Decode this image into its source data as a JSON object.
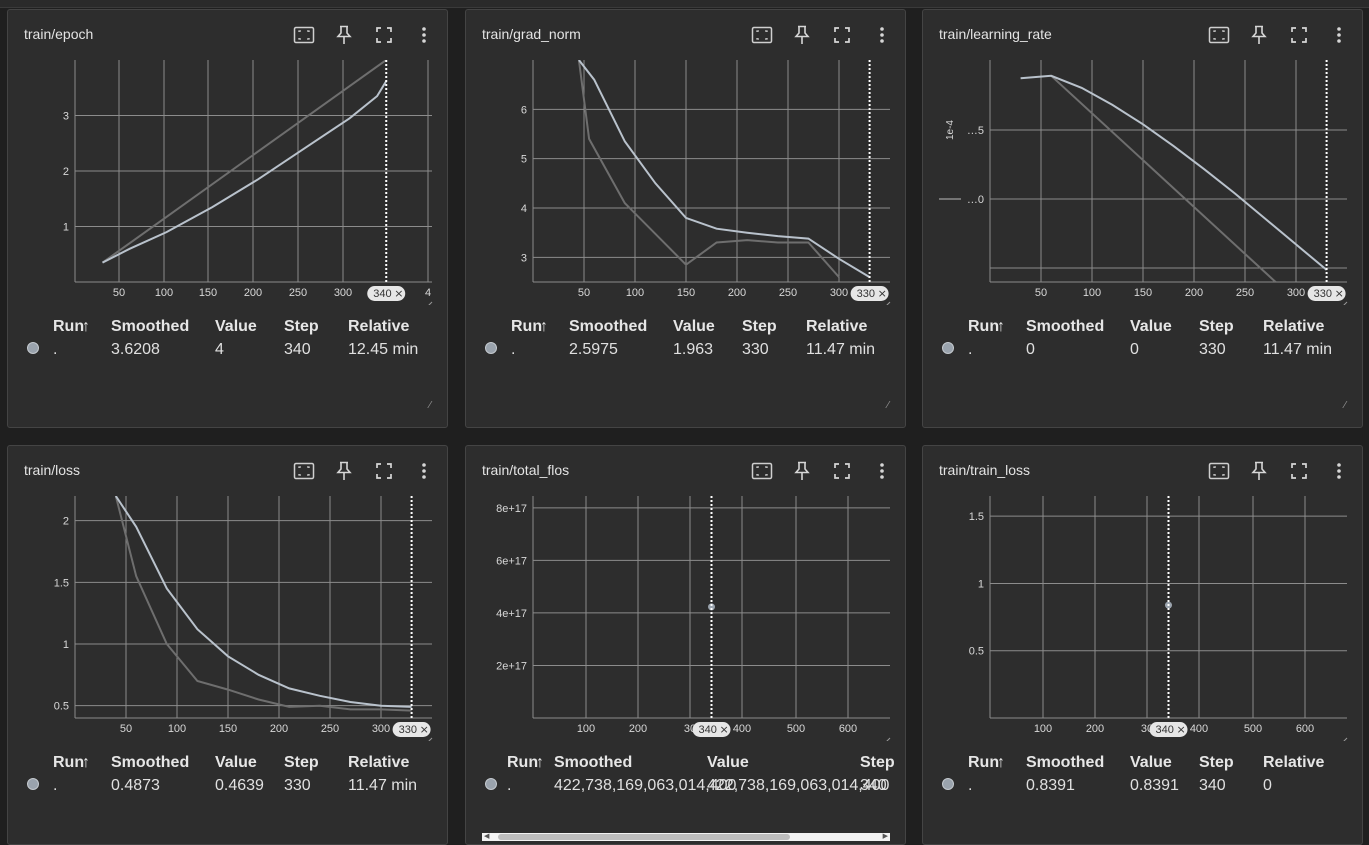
{
  "header": {
    "sort_arrow": "↑"
  },
  "cards": [
    {
      "title": "train/epoch",
      "plot": {
        "y_ticks": [
          "3",
          "2",
          "1"
        ],
        "x_ticks": [
          "50",
          "100",
          "150",
          "200",
          "250",
          "300",
          "4"
        ],
        "badge": "340",
        "y_axis_label": ""
      },
      "table": {
        "headers": [
          "Run",
          "Smoothed",
          "Value",
          "Step",
          "Relative"
        ],
        "row": {
          "run": ".",
          "smoothed": "3.6208",
          "value": "4",
          "step": "340",
          "relative": "12.45 min"
        }
      },
      "series_smoothed": [
        [
          30,
          0.35
        ],
        [
          60,
          0.6
        ],
        [
          100,
          0.9
        ],
        [
          150,
          1.35
        ],
        [
          200,
          1.85
        ],
        [
          250,
          2.4
        ],
        [
          300,
          2.95
        ],
        [
          330,
          3.35
        ],
        [
          340,
          3.62
        ]
      ],
      "series_raw": [
        [
          30,
          0.35
        ],
        [
          340,
          4.0
        ]
      ],
      "x_range": [
        0,
        390
      ],
      "y_range": [
        0,
        4
      ],
      "cursor_step": 340
    },
    {
      "title": "train/grad_norm",
      "plot": {
        "y_ticks": [
          "6",
          "5",
          "4",
          "3"
        ],
        "x_ticks": [
          "50",
          "100",
          "150",
          "200",
          "250",
          "300"
        ],
        "badge": "330",
        "y_axis_label": ""
      },
      "table": {
        "headers": [
          "Run",
          "Smoothed",
          "Value",
          "Step",
          "Relative"
        ],
        "row": {
          "run": ".",
          "smoothed": "2.5975",
          "value": "1.963",
          "step": "330",
          "relative": "11.47 min"
        }
      },
      "series_smoothed": [
        [
          45,
          7.0
        ],
        [
          60,
          6.6
        ],
        [
          90,
          5.35
        ],
        [
          120,
          4.5
        ],
        [
          150,
          3.8
        ],
        [
          180,
          3.58
        ],
        [
          210,
          3.5
        ],
        [
          240,
          3.43
        ],
        [
          270,
          3.38
        ],
        [
          300,
          2.97
        ],
        [
          330,
          2.6
        ]
      ],
      "series_raw": [
        [
          45,
          7.0
        ],
        [
          55,
          5.4
        ],
        [
          90,
          4.1
        ],
        [
          150,
          2.85
        ],
        [
          180,
          3.3
        ],
        [
          210,
          3.35
        ],
        [
          240,
          3.3
        ],
        [
          270,
          3.3
        ],
        [
          300,
          2.6
        ]
      ],
      "x_range": [
        0,
        350
      ],
      "y_range": [
        2.5,
        7.0
      ],
      "cursor_step": 330
    },
    {
      "title": "train/learning_rate",
      "plot": {
        "y_ticks": [
          "…5",
          "…0"
        ],
        "x_ticks": [
          "50",
          "100",
          "150",
          "200",
          "250",
          "300"
        ],
        "badge": "330",
        "y_axis_label": "1e-4"
      },
      "table": {
        "headers": [
          "Run",
          "Smoothed",
          "Value",
          "Step",
          "Relative"
        ],
        "row": {
          "run": ".",
          "smoothed": "0",
          "value": "0",
          "step": "330",
          "relative": "11.47 min"
        }
      },
      "series_smoothed": [
        [
          30,
          1.8
        ],
        [
          60,
          1.82
        ],
        [
          90,
          1.72
        ],
        [
          120,
          1.58
        ],
        [
          150,
          1.42
        ],
        [
          180,
          1.24
        ],
        [
          210,
          1.05
        ],
        [
          240,
          0.85
        ],
        [
          270,
          0.64
        ],
        [
          300,
          0.43
        ],
        [
          330,
          0.22
        ]
      ],
      "series_raw": [
        [
          60,
          1.82
        ],
        [
          280,
          0.12
        ]
      ],
      "x_range": [
        0,
        350
      ],
      "y_range": [
        0.12,
        1.95
      ],
      "cursor_step": 330
    },
    {
      "title": "train/loss",
      "plot": {
        "y_ticks": [
          "2",
          "1.5",
          "1",
          "0.5"
        ],
        "x_ticks": [
          "50",
          "100",
          "150",
          "200",
          "250",
          "300"
        ],
        "badge": "330",
        "y_axis_label": ""
      },
      "table": {
        "headers": [
          "Run",
          "Smoothed",
          "Value",
          "Step",
          "Relative"
        ],
        "row": {
          "run": ".",
          "smoothed": "0.4873",
          "value": "0.4639",
          "step": "330",
          "relative": "11.47 min"
        }
      },
      "series_smoothed": [
        [
          40,
          2.2
        ],
        [
          60,
          1.95
        ],
        [
          90,
          1.45
        ],
        [
          120,
          1.12
        ],
        [
          150,
          0.9
        ],
        [
          180,
          0.75
        ],
        [
          210,
          0.64
        ],
        [
          240,
          0.58
        ],
        [
          270,
          0.53
        ],
        [
          300,
          0.5
        ],
        [
          330,
          0.49
        ]
      ],
      "series_raw": [
        [
          40,
          2.2
        ],
        [
          60,
          1.55
        ],
        [
          90,
          1.0
        ],
        [
          120,
          0.7
        ],
        [
          150,
          0.63
        ],
        [
          180,
          0.55
        ],
        [
          210,
          0.49
        ],
        [
          240,
          0.5
        ],
        [
          270,
          0.47
        ],
        [
          300,
          0.47
        ],
        [
          330,
          0.46
        ]
      ],
      "x_range": [
        0,
        350
      ],
      "y_range": [
        0.4,
        2.2
      ],
      "cursor_step": 330
    },
    {
      "title": "train/total_flos",
      "plot": {
        "y_ticks": [
          "8e+17",
          "6e+17",
          "4e+17",
          "2e+17"
        ],
        "x_ticks": [
          "100",
          "200",
          "30",
          "400",
          "500",
          "600"
        ],
        "badge": "340",
        "y_axis_label": ""
      },
      "table": {
        "headers": [
          "Run",
          "Smoothed",
          "Value",
          "Step"
        ],
        "row": {
          "run": ".",
          "smoothed": "422,738,169,063,014,400",
          "value": "422,738,169,063,014,400",
          "step": "340"
        }
      },
      "series_smoothed": [],
      "series_raw": [],
      "point": [
        340,
        4.23
      ],
      "x_range": [
        0,
        680
      ],
      "y_range": [
        0,
        8.45
      ],
      "cursor_step": 340
    },
    {
      "title": "train/train_loss",
      "plot": {
        "y_ticks": [
          "1.5",
          "1",
          "0.5"
        ],
        "x_ticks": [
          "100",
          "200",
          "30",
          "400",
          "500",
          "600"
        ],
        "badge": "340",
        "y_axis_label": ""
      },
      "table": {
        "headers": [
          "Run",
          "Smoothed",
          "Value",
          "Step",
          "Relative"
        ],
        "row": {
          "run": ".",
          "smoothed": "0.8391",
          "value": "0.8391",
          "step": "340",
          "relative": "0"
        }
      },
      "series_smoothed": [],
      "series_raw": [],
      "point": [
        340,
        0.8391
      ],
      "x_range": [
        0,
        680
      ],
      "y_range": [
        0,
        1.65
      ],
      "cursor_step": 340
    }
  ],
  "colors": {
    "card_bg": "#2d2d2d",
    "grid": "#8c8c8c",
    "smoothed": "#b9c2cc",
    "raw": "#6e6e6e",
    "dot": "#9aa3ad"
  }
}
